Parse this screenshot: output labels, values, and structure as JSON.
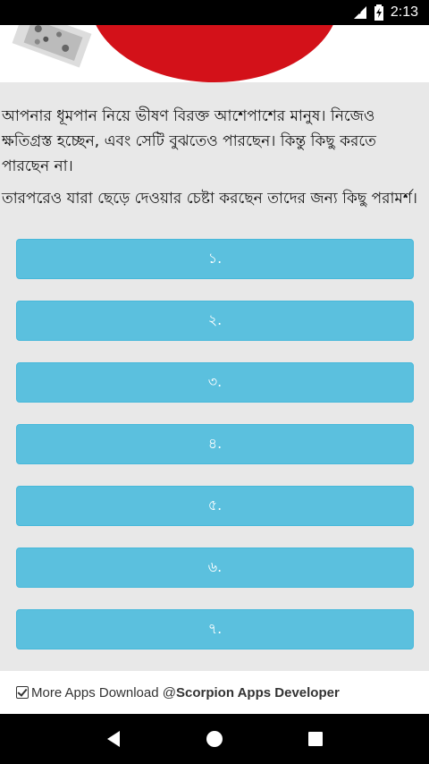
{
  "status_bar": {
    "time": "2:13",
    "icons": [
      "signal-off-icon",
      "battery-charging-icon"
    ]
  },
  "hero": {
    "image": "smoking-cigarette-banner",
    "colors": {
      "red": "#d31119"
    }
  },
  "intro": {
    "paragraph1": "আপনার ধূমপান নিয়ে ভীষণ বিরক্ত আশেপাশের মানুষ। নিজেও ক্ষতিগ্রস্ত হচ্ছেন, এবং সেটি বুঝতেও পারছেন। কিন্তু কিছু করতে পারছেন না।",
    "paragraph2": "তারপরেও যারা ছেড়ে দেওয়ার চেষ্টা করছেন তাদের জন্য কিছু পরামর্শ।"
  },
  "buttons": [
    {
      "label": "১."
    },
    {
      "label": "২."
    },
    {
      "label": "৩."
    },
    {
      "label": "৪."
    },
    {
      "label": "৫."
    },
    {
      "label": "৬."
    },
    {
      "label": "৭."
    }
  ],
  "footer": {
    "prefix": "More Apps Download @",
    "developer": "Scorpion Apps Developer"
  },
  "nav": [
    "back-icon",
    "home-icon",
    "recents-icon"
  ],
  "colors": {
    "button": "#5bc0de",
    "background": "#e8e8e8"
  }
}
